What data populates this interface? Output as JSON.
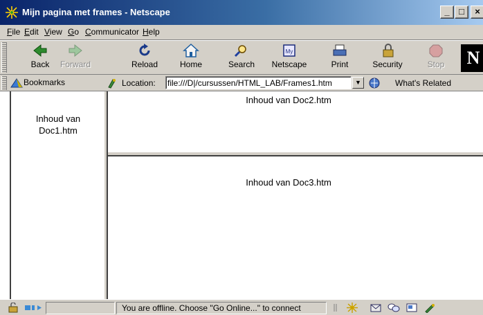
{
  "window": {
    "title": "Mijn pagina met frames - Netscape",
    "minimize_label": "_",
    "maximize_label": "□",
    "close_label": "×"
  },
  "menu": {
    "items": [
      {
        "label": "File",
        "key": "F"
      },
      {
        "label": "Edit",
        "key": "E"
      },
      {
        "label": "View",
        "key": "V"
      },
      {
        "label": "Go",
        "key": "G"
      },
      {
        "label": "Communicator",
        "key": "C"
      },
      {
        "label": "Help",
        "key": "H"
      }
    ]
  },
  "toolbar": {
    "items": [
      {
        "label": "Back",
        "icon": "back-arrow-icon",
        "enabled": true
      },
      {
        "label": "Forward",
        "icon": "forward-arrow-icon",
        "enabled": false
      },
      {
        "label": "Reload",
        "icon": "reload-icon",
        "enabled": true
      },
      {
        "label": "Home",
        "icon": "home-icon",
        "enabled": true
      },
      {
        "label": "Search",
        "icon": "search-icon",
        "enabled": true
      },
      {
        "label": "Netscape",
        "icon": "netscape-icon",
        "enabled": true
      },
      {
        "label": "Print",
        "icon": "print-icon",
        "enabled": true
      },
      {
        "label": "Security",
        "icon": "security-lock-icon",
        "enabled": true
      },
      {
        "label": "Stop",
        "icon": "stop-icon",
        "enabled": false
      }
    ],
    "logo_letter": "N"
  },
  "location_bar": {
    "bookmarks_label": "Bookmarks",
    "location_label": "Location:",
    "url": "file:///D|/cursussen/HTML_LAB/Frames1.htm",
    "whats_related_label": "What's Related"
  },
  "frames": {
    "left_text": "Inhoud van\nDoc1.htm",
    "top_text": "Inhoud van Doc2.htm",
    "bottom_text": "Inhoud van Doc3.htm"
  },
  "status": {
    "message": "You are offline. Choose \"Go Online...\" to connect"
  },
  "colors": {
    "titlebar_start": "#0a246a",
    "titlebar_end": "#a6caf0",
    "chrome": "#d4d0c8"
  }
}
